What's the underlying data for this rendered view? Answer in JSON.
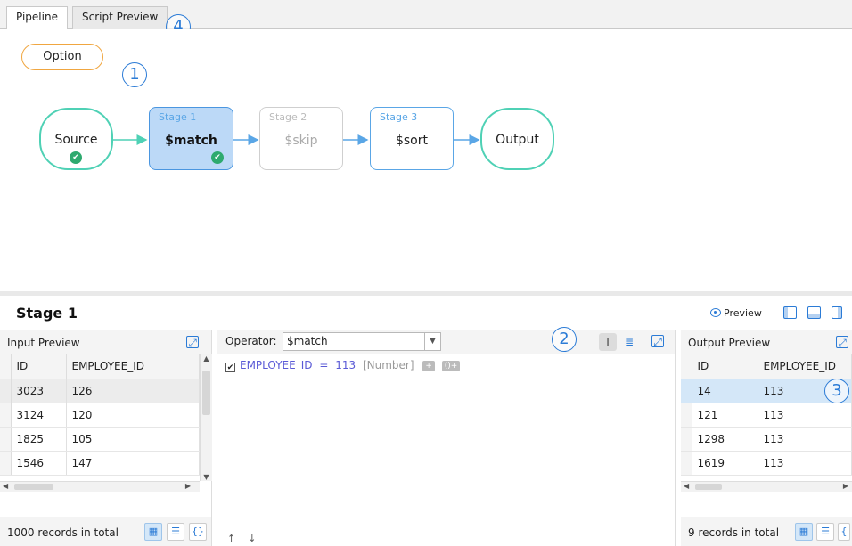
{
  "tabs": [
    "Pipeline",
    "Script Preview"
  ],
  "badges": [
    "1",
    "2",
    "3",
    "4"
  ],
  "option_label": "Option",
  "pipeline": {
    "source": "Source",
    "output": "Output",
    "stages": [
      {
        "label": "Stage 1",
        "op": "$match",
        "state": "selected",
        "valid": true
      },
      {
        "label": "Stage 2",
        "op": "$skip",
        "state": "disabled"
      },
      {
        "label": "Stage 3",
        "op": "$sort",
        "state": "normal"
      }
    ]
  },
  "stage_panel": {
    "title": "Stage 1",
    "preview_label": "Preview"
  },
  "input_preview": {
    "title": "Input Preview",
    "columns": [
      "ID",
      "EMPLOYEE_ID"
    ],
    "rows": [
      [
        "3023",
        "126"
      ],
      [
        "3124",
        "120"
      ],
      [
        "1825",
        "105"
      ],
      [
        "1546",
        "147"
      ]
    ],
    "footer": "1000 records in total"
  },
  "operator": {
    "label": "Operator:",
    "value": "$match",
    "condition": {
      "field": "EMPLOYEE_ID",
      "op": "=",
      "value": "113",
      "type": "[Number]"
    }
  },
  "output_preview": {
    "title": "Output Preview",
    "columns": [
      "ID",
      "EMPLOYEE_ID"
    ],
    "rows": [
      [
        "14",
        "113"
      ],
      [
        "121",
        "113"
      ],
      [
        "1298",
        "113"
      ],
      [
        "1619",
        "113"
      ]
    ],
    "footer": "9 records in total"
  },
  "colors": {
    "accent": "#2b7bd6",
    "pill_border": "#4fd1b5",
    "option_border": "#f0a640",
    "selected_stage": "#bcd9f7"
  }
}
